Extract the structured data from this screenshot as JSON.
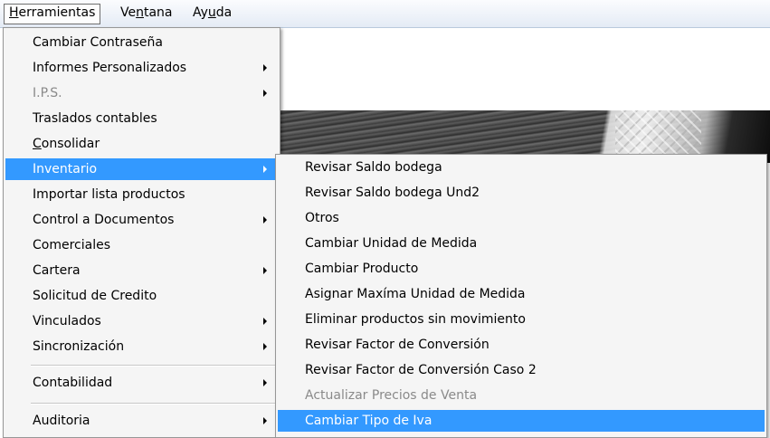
{
  "menubar": {
    "items": [
      {
        "label": "Herramientas",
        "mnemonic": "H",
        "rest": "erramientas",
        "active": true
      },
      {
        "label": "Ventana",
        "pre": "Ve",
        "mnemonic": "n",
        "rest": "tana"
      },
      {
        "label": "Ayuda",
        "pre": "Ay",
        "mnemonic": "u",
        "rest": "da"
      }
    ]
  },
  "main_menu": {
    "items": [
      {
        "label": "Cambiar Contraseña"
      },
      {
        "label": "Informes Personalizados",
        "submenu": true
      },
      {
        "label": "I.P.S.",
        "submenu": true,
        "disabled": true
      },
      {
        "label": "Traslados contables"
      },
      {
        "label": "Consolidar",
        "mnemonic": "C",
        "rest": "onsolidar"
      },
      {
        "label": "Inventario",
        "submenu": true,
        "highlighted": true
      },
      {
        "label": "Importar lista productos"
      },
      {
        "label": "Control a Documentos",
        "submenu": true
      },
      {
        "label": "Comerciales"
      },
      {
        "label": "Cartera",
        "submenu": true
      },
      {
        "label": "Solicitud de Credito"
      },
      {
        "label": "Vinculados",
        "submenu": true
      },
      {
        "label": "Sincronización",
        "submenu": true
      },
      {
        "label": "Contabilidad",
        "submenu": true
      },
      {
        "label": "Auditoria",
        "submenu": true
      }
    ]
  },
  "sub_menu": {
    "items": [
      {
        "label": "Revisar Saldo bodega"
      },
      {
        "label": "Revisar Saldo bodega Und2"
      },
      {
        "label": "Otros"
      },
      {
        "label": "Cambiar Unidad de Medida"
      },
      {
        "label": "Cambiar Producto"
      },
      {
        "label": "Asignar Maxíma Unidad de Medida"
      },
      {
        "label": "Eliminar productos sin movimiento"
      },
      {
        "label": "Revisar Factor de Conversión"
      },
      {
        "label": "Revisar Factor de Conversión Caso 2"
      },
      {
        "label": "Actualizar Precios de Venta",
        "disabled": true
      },
      {
        "label": "Cambiar Tipo de Iva",
        "highlighted": true
      }
    ]
  },
  "colors": {
    "highlight": "#3399ff",
    "menu_bg": "#f5f5f5",
    "disabled_text": "#8a8a8a"
  }
}
